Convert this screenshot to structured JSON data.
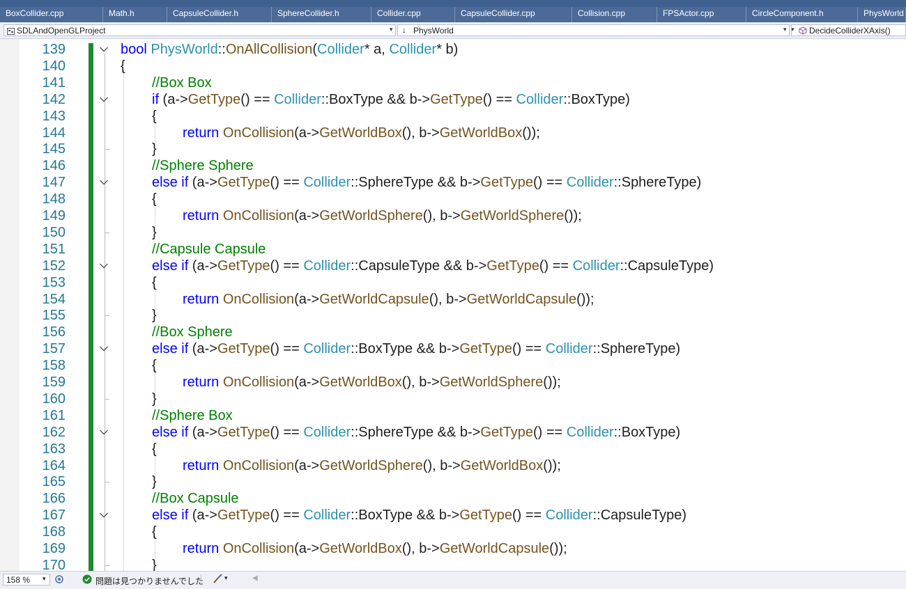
{
  "tabs": [
    {
      "label": "BoxCollider.cpp",
      "width": 148
    },
    {
      "label": "Math.h",
      "width": 92
    },
    {
      "label": "CapsuleCollider.h",
      "width": 150
    },
    {
      "label": "SphereCollider.h",
      "width": 143
    },
    {
      "label": "Collider.cpp",
      "width": 120
    },
    {
      "label": "CapsuleCollider.cpp",
      "width": 168
    },
    {
      "label": "Collision.cpp",
      "width": 122
    },
    {
      "label": "FPSActor.cpp",
      "width": 128
    },
    {
      "label": "CircleComponent.h",
      "width": 160
    },
    {
      "label": "PhysWorld",
      "width": 69
    }
  ],
  "nav": {
    "project": "SDLAndOpenGLProject",
    "scope": "PhysWorld",
    "member": "DecideColliderXAxis()"
  },
  "colors": {
    "tab_strip": "#3f5f8f",
    "keyword": "#0000ff",
    "type": "#2b91af",
    "function": "#74531f",
    "comment": "#008000",
    "line_number": "#237893",
    "change_bar": "#1f8a2d"
  },
  "lines": [
    {
      "num": "139",
      "fold": "down",
      "tokens": [
        [
          "kw",
          "bool"
        ],
        [
          "tx",
          " "
        ],
        [
          "ty",
          "PhysWorld"
        ],
        [
          "tx",
          "::"
        ],
        [
          "fn",
          "OnAllCollision"
        ],
        [
          "tx",
          "("
        ],
        [
          "ty",
          "Collider"
        ],
        [
          "tx",
          "* a, "
        ],
        [
          "ty",
          "Collider"
        ],
        [
          "tx",
          "* b)"
        ]
      ]
    },
    {
      "num": "140",
      "fold": "",
      "tokens": [
        [
          "tx",
          "{"
        ]
      ]
    },
    {
      "num": "141",
      "fold": "",
      "tokens": [
        [
          "cm",
          "//Box Box"
        ]
      ]
    },
    {
      "num": "142",
      "fold": "down",
      "tokens": [
        [
          "kw",
          "if"
        ],
        [
          "tx",
          " (a->"
        ],
        [
          "fn",
          "GetType"
        ],
        [
          "tx",
          "() == "
        ],
        [
          "ty",
          "Collider"
        ],
        [
          "tx",
          "::BoxType && b->"
        ],
        [
          "fn",
          "GetType"
        ],
        [
          "tx",
          "() == "
        ],
        [
          "ty",
          "Collider"
        ],
        [
          "tx",
          "::BoxType)"
        ]
      ]
    },
    {
      "num": "143",
      "fold": "",
      "tokens": [
        [
          "tx",
          "{"
        ]
      ]
    },
    {
      "num": "144",
      "fold": "",
      "tokens": [
        [
          "kw",
          "return"
        ],
        [
          "tx",
          " "
        ],
        [
          "fn",
          "OnCollision"
        ],
        [
          "tx",
          "(a->"
        ],
        [
          "fn",
          "GetWorldBox"
        ],
        [
          "tx",
          "(), b->"
        ],
        [
          "fn",
          "GetWorldBox"
        ],
        [
          "tx",
          "());"
        ]
      ]
    },
    {
      "num": "145",
      "fold": "",
      "tokens": [
        [
          "tx",
          "}"
        ]
      ]
    },
    {
      "num": "146",
      "fold": "",
      "tokens": [
        [
          "cm",
          "//Sphere Sphere"
        ]
      ]
    },
    {
      "num": "147",
      "fold": "down",
      "tokens": [
        [
          "kw",
          "else if"
        ],
        [
          "tx",
          " (a->"
        ],
        [
          "fn",
          "GetType"
        ],
        [
          "tx",
          "() == "
        ],
        [
          "ty",
          "Collider"
        ],
        [
          "tx",
          "::SphereType && b->"
        ],
        [
          "fn",
          "GetType"
        ],
        [
          "tx",
          "() == "
        ],
        [
          "ty",
          "Collider"
        ],
        [
          "tx",
          "::SphereType)"
        ]
      ]
    },
    {
      "num": "148",
      "fold": "",
      "tokens": [
        [
          "tx",
          "{"
        ]
      ]
    },
    {
      "num": "149",
      "fold": "",
      "tokens": [
        [
          "kw",
          "return"
        ],
        [
          "tx",
          " "
        ],
        [
          "fn",
          "OnCollision"
        ],
        [
          "tx",
          "(a->"
        ],
        [
          "fn",
          "GetWorldSphere"
        ],
        [
          "tx",
          "(), b->"
        ],
        [
          "fn",
          "GetWorldSphere"
        ],
        [
          "tx",
          "());"
        ]
      ]
    },
    {
      "num": "150",
      "fold": "",
      "tokens": [
        [
          "tx",
          "}"
        ]
      ]
    },
    {
      "num": "151",
      "fold": "",
      "tokens": [
        [
          "cm",
          "//Capsule Capsule"
        ]
      ]
    },
    {
      "num": "152",
      "fold": "down",
      "tokens": [
        [
          "kw",
          "else if"
        ],
        [
          "tx",
          " (a->"
        ],
        [
          "fn",
          "GetType"
        ],
        [
          "tx",
          "() == "
        ],
        [
          "ty",
          "Collider"
        ],
        [
          "tx",
          "::CapsuleType && b->"
        ],
        [
          "fn",
          "GetType"
        ],
        [
          "tx",
          "() == "
        ],
        [
          "ty",
          "Collider"
        ],
        [
          "tx",
          "::CapsuleType)"
        ]
      ]
    },
    {
      "num": "153",
      "fold": "",
      "tokens": [
        [
          "tx",
          "{"
        ]
      ]
    },
    {
      "num": "154",
      "fold": "",
      "tokens": [
        [
          "kw",
          "return"
        ],
        [
          "tx",
          " "
        ],
        [
          "fn",
          "OnCollision"
        ],
        [
          "tx",
          "(a->"
        ],
        [
          "fn",
          "GetWorldCapsule"
        ],
        [
          "tx",
          "(), b->"
        ],
        [
          "fn",
          "GetWorldCapsule"
        ],
        [
          "tx",
          "());"
        ]
      ]
    },
    {
      "num": "155",
      "fold": "",
      "tokens": [
        [
          "tx",
          "}"
        ]
      ]
    },
    {
      "num": "156",
      "fold": "",
      "tokens": [
        [
          "cm",
          "//Box Sphere"
        ]
      ]
    },
    {
      "num": "157",
      "fold": "down",
      "tokens": [
        [
          "kw",
          "else if"
        ],
        [
          "tx",
          " (a->"
        ],
        [
          "fn",
          "GetType"
        ],
        [
          "tx",
          "() == "
        ],
        [
          "ty",
          "Collider"
        ],
        [
          "tx",
          "::BoxType && b->"
        ],
        [
          "fn",
          "GetType"
        ],
        [
          "tx",
          "() == "
        ],
        [
          "ty",
          "Collider"
        ],
        [
          "tx",
          "::SphereType)"
        ]
      ]
    },
    {
      "num": "158",
      "fold": "",
      "tokens": [
        [
          "tx",
          "{"
        ]
      ]
    },
    {
      "num": "159",
      "fold": "",
      "tokens": [
        [
          "kw",
          "return"
        ],
        [
          "tx",
          " "
        ],
        [
          "fn",
          "OnCollision"
        ],
        [
          "tx",
          "(a->"
        ],
        [
          "fn",
          "GetWorldBox"
        ],
        [
          "tx",
          "(), b->"
        ],
        [
          "fn",
          "GetWorldSphere"
        ],
        [
          "tx",
          "());"
        ]
      ]
    },
    {
      "num": "160",
      "fold": "",
      "tokens": [
        [
          "tx",
          "}"
        ]
      ]
    },
    {
      "num": "161",
      "fold": "",
      "tokens": [
        [
          "cm",
          "//Sphere Box"
        ]
      ]
    },
    {
      "num": "162",
      "fold": "down",
      "tokens": [
        [
          "kw",
          "else if"
        ],
        [
          "tx",
          " (a->"
        ],
        [
          "fn",
          "GetType"
        ],
        [
          "tx",
          "() == "
        ],
        [
          "ty",
          "Collider"
        ],
        [
          "tx",
          "::SphereType && b->"
        ],
        [
          "fn",
          "GetType"
        ],
        [
          "tx",
          "() == "
        ],
        [
          "ty",
          "Collider"
        ],
        [
          "tx",
          "::BoxType)"
        ]
      ]
    },
    {
      "num": "163",
      "fold": "",
      "tokens": [
        [
          "tx",
          "{"
        ]
      ]
    },
    {
      "num": "164",
      "fold": "",
      "tokens": [
        [
          "kw",
          "return"
        ],
        [
          "tx",
          " "
        ],
        [
          "fn",
          "OnCollision"
        ],
        [
          "tx",
          "(a->"
        ],
        [
          "fn",
          "GetWorldSphere"
        ],
        [
          "tx",
          "(), b->"
        ],
        [
          "fn",
          "GetWorldBox"
        ],
        [
          "tx",
          "());"
        ]
      ]
    },
    {
      "num": "165",
      "fold": "",
      "tokens": [
        [
          "tx",
          "}"
        ]
      ]
    },
    {
      "num": "166",
      "fold": "",
      "tokens": [
        [
          "cm",
          "//Box Capsule"
        ]
      ]
    },
    {
      "num": "167",
      "fold": "down",
      "tokens": [
        [
          "kw",
          "else if"
        ],
        [
          "tx",
          " (a->"
        ],
        [
          "fn",
          "GetType"
        ],
        [
          "tx",
          "() == "
        ],
        [
          "ty",
          "Collider"
        ],
        [
          "tx",
          "::BoxType && b->"
        ],
        [
          "fn",
          "GetType"
        ],
        [
          "tx",
          "() == "
        ],
        [
          "ty",
          "Collider"
        ],
        [
          "tx",
          "::CapsuleType)"
        ]
      ]
    },
    {
      "num": "168",
      "fold": "",
      "tokens": [
        [
          "tx",
          "{"
        ]
      ]
    },
    {
      "num": "169",
      "fold": "",
      "tokens": [
        [
          "kw",
          "return"
        ],
        [
          "tx",
          " "
        ],
        [
          "fn",
          "OnCollision"
        ],
        [
          "tx",
          "(a->"
        ],
        [
          "fn",
          "GetWorldBox"
        ],
        [
          "tx",
          "(), b->"
        ],
        [
          "fn",
          "GetWorldCapsule"
        ],
        [
          "tx",
          "());"
        ]
      ]
    },
    {
      "num": "170",
      "fold": "",
      "tokens": [
        [
          "tx",
          "}"
        ]
      ]
    }
  ],
  "status": {
    "zoom": "158 %",
    "issues": "問題は見つかりませんでした"
  }
}
